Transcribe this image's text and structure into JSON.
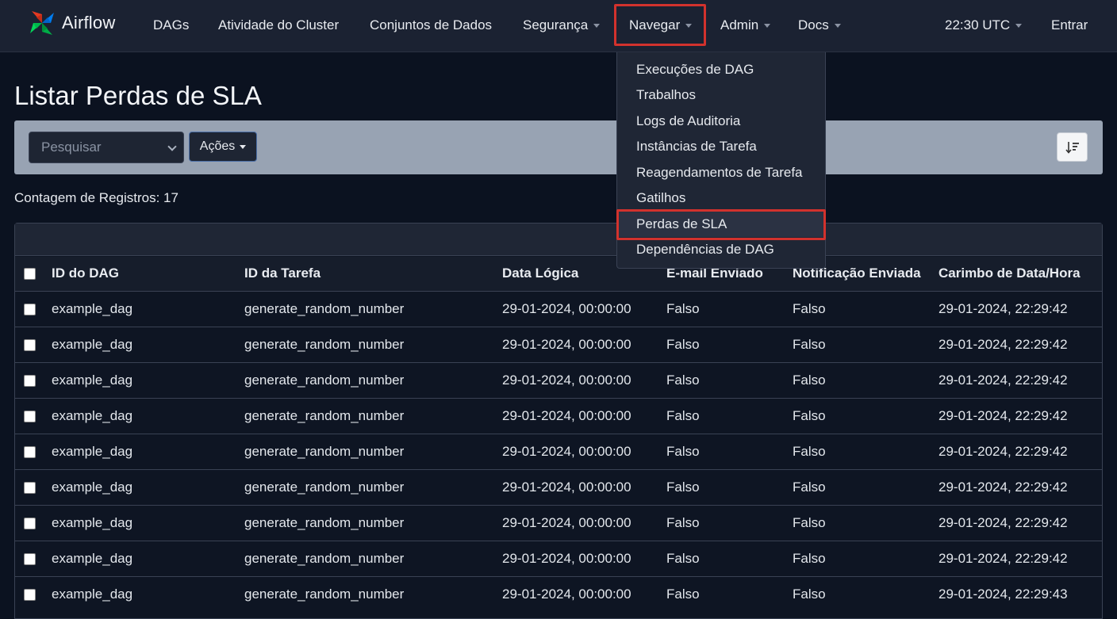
{
  "brand": {
    "name": "Airflow"
  },
  "nav": {
    "dags": "DAGs",
    "cluster_activity": "Atividade do Cluster",
    "datasets": "Conjuntos de Dados",
    "security": "Segurança",
    "browse": "Navegar",
    "admin": "Admin",
    "docs": "Docs",
    "time": "22:30 UTC",
    "login": "Entrar"
  },
  "browse_menu": {
    "items": [
      "Execuções de DAG",
      "Trabalhos",
      "Logs de Auditoria",
      "Instâncias de Tarefa",
      "Reagendamentos de Tarefa",
      "Gatilhos",
      "Perdas de SLA",
      "Dependências de DAG"
    ],
    "active": "Perdas de SLA"
  },
  "page": {
    "title": "Listar Perdas de SLA",
    "search_placeholder": "Pesquisar",
    "actions_label": "Ações",
    "record_count": "Contagem de Registros: 17"
  },
  "table": {
    "headers": [
      "ID do DAG",
      "ID da Tarefa",
      "Data Lógica",
      "E-mail Enviado",
      "Notificação Enviada",
      "Carimbo de Data/Hora"
    ],
    "rows": [
      [
        "example_dag",
        "generate_random_number",
        "29-01-2024, 00:00:00",
        "Falso",
        "Falso",
        "29-01-2024, 22:29:42"
      ],
      [
        "example_dag",
        "generate_random_number",
        "29-01-2024, 00:00:00",
        "Falso",
        "Falso",
        "29-01-2024, 22:29:42"
      ],
      [
        "example_dag",
        "generate_random_number",
        "29-01-2024, 00:00:00",
        "Falso",
        "Falso",
        "29-01-2024, 22:29:42"
      ],
      [
        "example_dag",
        "generate_random_number",
        "29-01-2024, 00:00:00",
        "Falso",
        "Falso",
        "29-01-2024, 22:29:42"
      ],
      [
        "example_dag",
        "generate_random_number",
        "29-01-2024, 00:00:00",
        "Falso",
        "Falso",
        "29-01-2024, 22:29:42"
      ],
      [
        "example_dag",
        "generate_random_number",
        "29-01-2024, 00:00:00",
        "Falso",
        "Falso",
        "29-01-2024, 22:29:42"
      ],
      [
        "example_dag",
        "generate_random_number",
        "29-01-2024, 00:00:00",
        "Falso",
        "Falso",
        "29-01-2024, 22:29:42"
      ],
      [
        "example_dag",
        "generate_random_number",
        "29-01-2024, 00:00:00",
        "Falso",
        "Falso",
        "29-01-2024, 22:29:42"
      ],
      [
        "example_dag",
        "generate_random_number",
        "29-01-2024, 00:00:00",
        "Falso",
        "Falso",
        "29-01-2024, 22:29:43"
      ]
    ]
  },
  "colors": {
    "highlight": "#d2322d",
    "navbar_bg": "#1b2232",
    "page_bg": "#0b1220"
  },
  "icons": {
    "brand": "airflow-pinwheel-icon",
    "sort": "sort-amount-icon"
  }
}
